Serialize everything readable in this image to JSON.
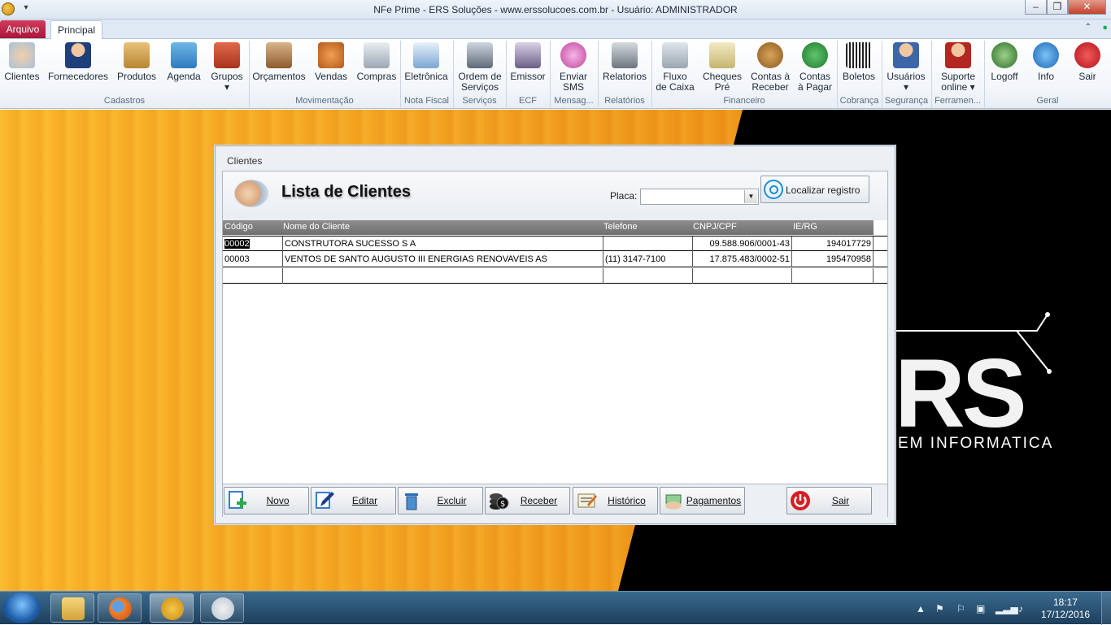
{
  "window": {
    "title": "NFe Prime - ERS Soluções - www.erssolucoes.com.br - Usuário: ADMINISTRADOR",
    "minimize": "–",
    "maximize": "❒",
    "close": "✕"
  },
  "tabs": {
    "arquivo": "Arquivo",
    "principal": "Principal"
  },
  "ribbon": {
    "buttons": [
      {
        "label": "Clientes",
        "label2": ""
      },
      {
        "label": "Fornecedores",
        "label2": ""
      },
      {
        "label": "Produtos",
        "label2": ""
      },
      {
        "label": "Agenda",
        "label2": ""
      },
      {
        "label": "Grupos",
        "label2": "▾"
      },
      {
        "label": "Orçamentos",
        "label2": ""
      },
      {
        "label": "Vendas",
        "label2": ""
      },
      {
        "label": "Compras",
        "label2": ""
      },
      {
        "label": "Eletrônica",
        "label2": ""
      },
      {
        "label": "Ordem de",
        "label2": "Serviços"
      },
      {
        "label": "Emissor",
        "label2": ""
      },
      {
        "label": "Enviar",
        "label2": "SMS"
      },
      {
        "label": "Relatorios",
        "label2": ""
      },
      {
        "label": "Fluxo",
        "label2": "de Caixa"
      },
      {
        "label": "Cheques",
        "label2": "Pré"
      },
      {
        "label": "Contas à",
        "label2": "Receber"
      },
      {
        "label": "Contas",
        "label2": "à Pagar"
      },
      {
        "label": "Boletos",
        "label2": ""
      },
      {
        "label": "Usuários",
        "label2": "▾"
      },
      {
        "label": "Suporte",
        "label2": "online ▾"
      },
      {
        "label": "Logoff",
        "label2": ""
      },
      {
        "label": "Info",
        "label2": ""
      },
      {
        "label": "Sair",
        "label2": ""
      }
    ],
    "groups": [
      "Cadastros",
      "Movimentação",
      "Nota Fiscal",
      "Serviços",
      "ECF",
      "Mensag...",
      "Relatórios",
      "Financeiro",
      "Cobrança",
      "Segurança",
      "Ferramen...",
      "Geral"
    ]
  },
  "background": {
    "brand": "RS",
    "tagline": "EM INFORMATICA"
  },
  "dialog": {
    "title": "Clientes",
    "heading": "Lista de Clientes",
    "placa_label": "Placa:",
    "placa_value": "",
    "search_button": "Localizar registro",
    "columns": [
      "Código",
      "Nome do Cliente",
      "Telefone",
      "CNPJ/CPF",
      "IE/RG"
    ],
    "rows": [
      {
        "codigo": "00002",
        "nome": "CONSTRUTORA SUCESSO S A",
        "telefone": "",
        "cnpj": "09.588.906/0001-43",
        "ie": "194017729"
      },
      {
        "codigo": "00003",
        "nome": "VENTOS DE SANTO AUGUSTO III ENERGIAS RENOVAVEIS AS",
        "telefone": "(11) 3147-7100",
        "cnpj": "17.875.483/0002-51",
        "ie": "195470958"
      }
    ],
    "buttons": {
      "novo": "Novo",
      "editar": "Editar",
      "excluir": "Excluir",
      "receber": "Receber",
      "historico": "Histórico",
      "pagamentos": "Pagamentos",
      "sair": "Sair"
    }
  },
  "taskbar": {
    "time": "18:17",
    "date": "17/12/2016"
  },
  "colors": {
    "accent_red": "#c0203f",
    "ribbon_bg": "#f3f6fa",
    "orange": "#f6a81f"
  }
}
